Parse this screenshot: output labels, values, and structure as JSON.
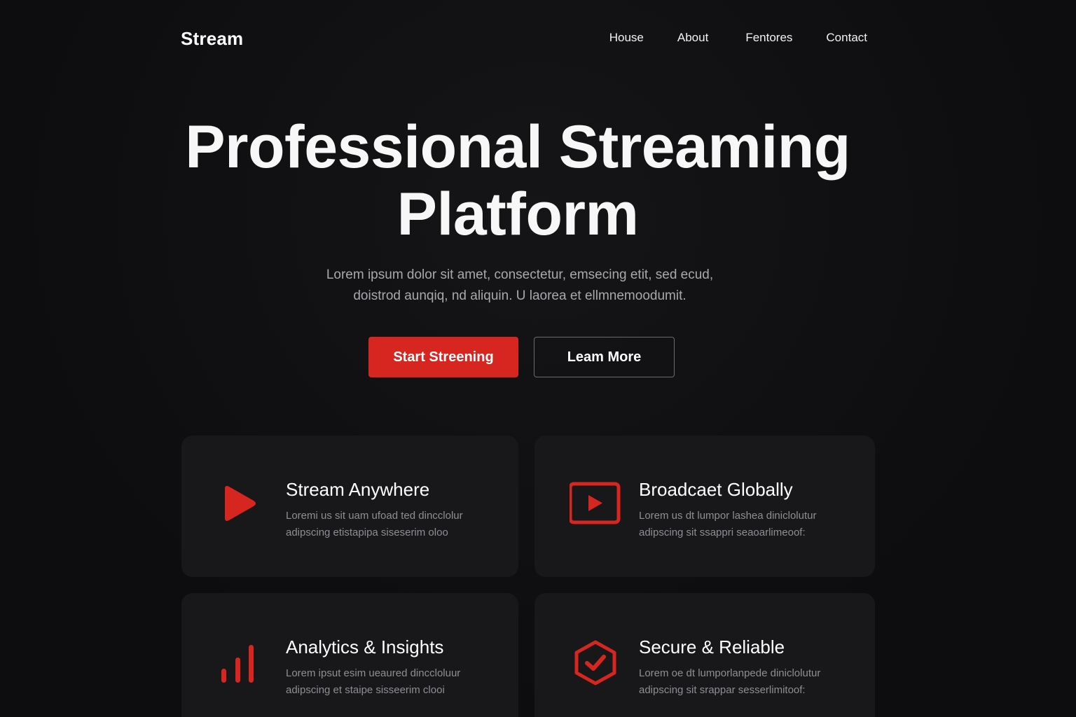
{
  "brand": {
    "name": "Stream"
  },
  "nav": {
    "items": [
      {
        "label": "House"
      },
      {
        "label": "About"
      },
      {
        "label": "Fentores"
      },
      {
        "label": "Contact"
      }
    ]
  },
  "hero": {
    "title_line1": "Professional Streaming",
    "title_line2": "Platform",
    "subtitle_line1": "Lorem ipsum dolor sit amet, consectetur, emsecing etit, sed ecud,",
    "subtitle_line2": "doistrod aunqiq, nd aliquin. U laorea et ellmnemoodumit.",
    "primary_button": "Start Streening",
    "secondary_button": "Leam More"
  },
  "features": [
    {
      "icon": "play-icon",
      "title": "Stream Anywhere",
      "text_line1": "Loremi us sit uam ufoad ted dincclolur",
      "text_line2": "adipscing etistapipa siseserim oloo"
    },
    {
      "icon": "video-play-icon",
      "title": "Broadcaet Globally",
      "text_line1": "Lorem us dt lumpor lashea diniclolutur",
      "text_line2": "adipscing sit ssappri seaoarlimeoof:"
    },
    {
      "icon": "bar-chart-icon",
      "title": "Analytics & Insights",
      "text_line1": "Lorem ipsut esim ueaured dinccloluur",
      "text_line2": "adipscing et staipe sisseerim clooi"
    },
    {
      "icon": "shield-check-icon",
      "title": "Secure & Reliable",
      "text_line1": "Lorem oe dt lumporlanpede diniclolutur",
      "text_line2": "adipscing sit srappar sesserlimitoof:"
    }
  ],
  "colors": {
    "accent": "#d7261f",
    "background": "#0e0e10",
    "card": "#18181b"
  }
}
